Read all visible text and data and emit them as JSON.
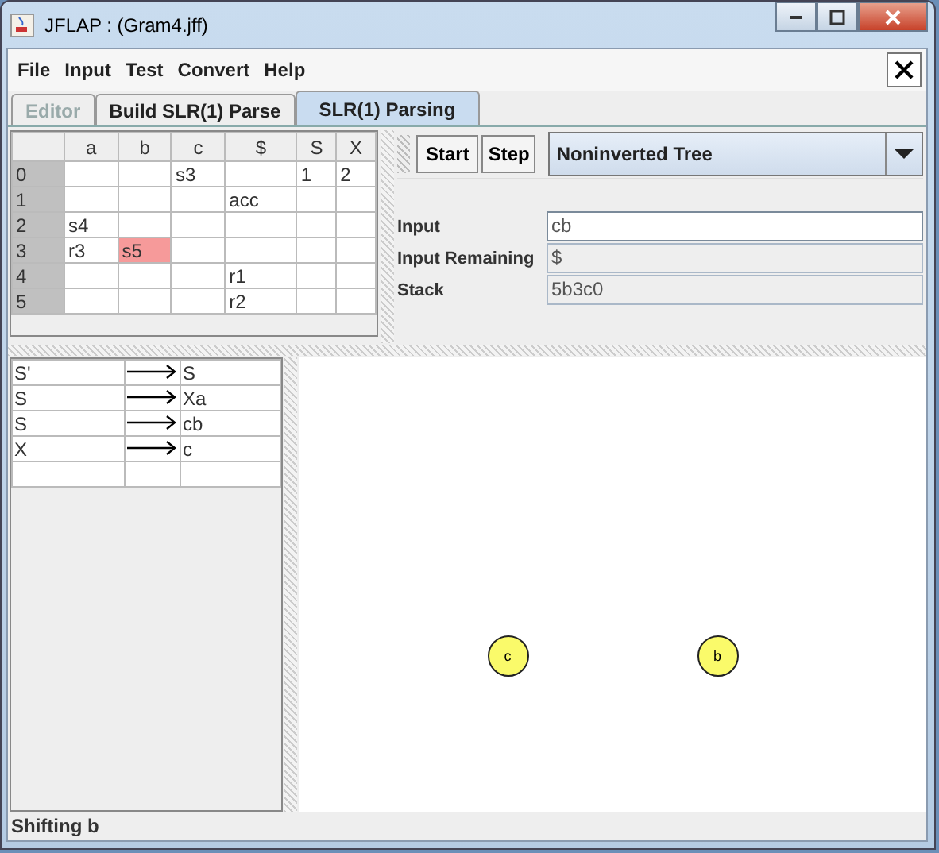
{
  "window": {
    "title": "JFLAP : (Gram4.jff)"
  },
  "menu": [
    "File",
    "Input",
    "Test",
    "Convert",
    "Help"
  ],
  "tabs": [
    {
      "label": "Editor",
      "selected": false,
      "disabled": true
    },
    {
      "label": "Build SLR(1) Parse",
      "selected": false,
      "disabled": false
    },
    {
      "label": "SLR(1) Parsing",
      "selected": true,
      "disabled": false
    }
  ],
  "parse_table": {
    "columns": [
      "a",
      "b",
      "c",
      "$",
      "S",
      "X"
    ],
    "rows": [
      {
        "state": "0",
        "cells": [
          null,
          null,
          {
            "text": "s3",
            "selected": false
          },
          null,
          {
            "text": "1",
            "selected": false
          },
          {
            "text": "2",
            "selected": false
          }
        ]
      },
      {
        "state": "1",
        "cells": [
          null,
          null,
          null,
          {
            "text": "acc",
            "selected": false
          },
          null,
          null
        ]
      },
      {
        "state": "2",
        "cells": [
          {
            "text": "s4",
            "selected": false
          },
          null,
          null,
          null,
          null,
          null
        ]
      },
      {
        "state": "3",
        "cells": [
          {
            "text": "r3",
            "selected": false
          },
          {
            "text": "s5",
            "selected": true
          },
          null,
          null,
          null,
          null
        ]
      },
      {
        "state": "4",
        "cells": [
          null,
          null,
          null,
          {
            "text": "r1",
            "selected": false
          },
          null,
          null
        ]
      },
      {
        "state": "5",
        "cells": [
          null,
          null,
          null,
          {
            "text": "r2",
            "selected": false
          },
          null,
          null
        ]
      }
    ]
  },
  "controls": {
    "buttons": [
      "Start",
      "Step"
    ],
    "view_select": "Noninverted Tree"
  },
  "fields": [
    {
      "label": "Input",
      "value": "cb",
      "editable": true
    },
    {
      "label": "Input Remaining",
      "value": "$",
      "editable": false
    },
    {
      "label": "Stack",
      "value": "5b3c0",
      "editable": false
    }
  ],
  "grammar": [
    {
      "lhs": "S'",
      "rhs": "S"
    },
    {
      "lhs": "S",
      "rhs": "Xa"
    },
    {
      "lhs": "S",
      "rhs": "cb"
    },
    {
      "lhs": "X",
      "rhs": "c"
    }
  ],
  "tree_nodes": [
    "c",
    "b"
  ],
  "status_bar": "Shifting b"
}
